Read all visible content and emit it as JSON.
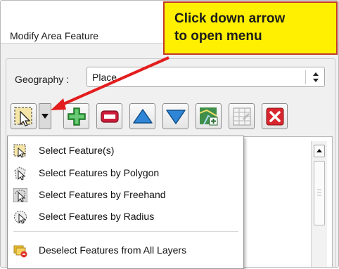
{
  "dialog": {
    "title": "Modify Area Feature"
  },
  "geography": {
    "label": "Geography :",
    "value": "Place"
  },
  "toolbar": {
    "buttons": [
      "select-features-icon",
      "add-icon",
      "remove-icon",
      "move-up-icon",
      "move-down-icon",
      "map-icon",
      "table-icon",
      "close-icon"
    ]
  },
  "menu": {
    "items": [
      {
        "label": "Select Feature(s)",
        "icon": "select-rectangle-icon"
      },
      {
        "label": "Select Features by Polygon",
        "icon": "select-polygon-icon"
      },
      {
        "label": "Select Features by Freehand",
        "icon": "select-freehand-icon"
      },
      {
        "label": "Select Features by Radius",
        "icon": "select-radius-icon"
      },
      {
        "label": "Deselect Features from All Layers",
        "icon": "deselect-icon"
      }
    ]
  },
  "callout": {
    "line1": "Click down arrow",
    "line2": "to open menu"
  },
  "colors": {
    "callout_bg": "#ffef00",
    "callout_border": "#c0392b",
    "arrow": "#e31d1d"
  }
}
